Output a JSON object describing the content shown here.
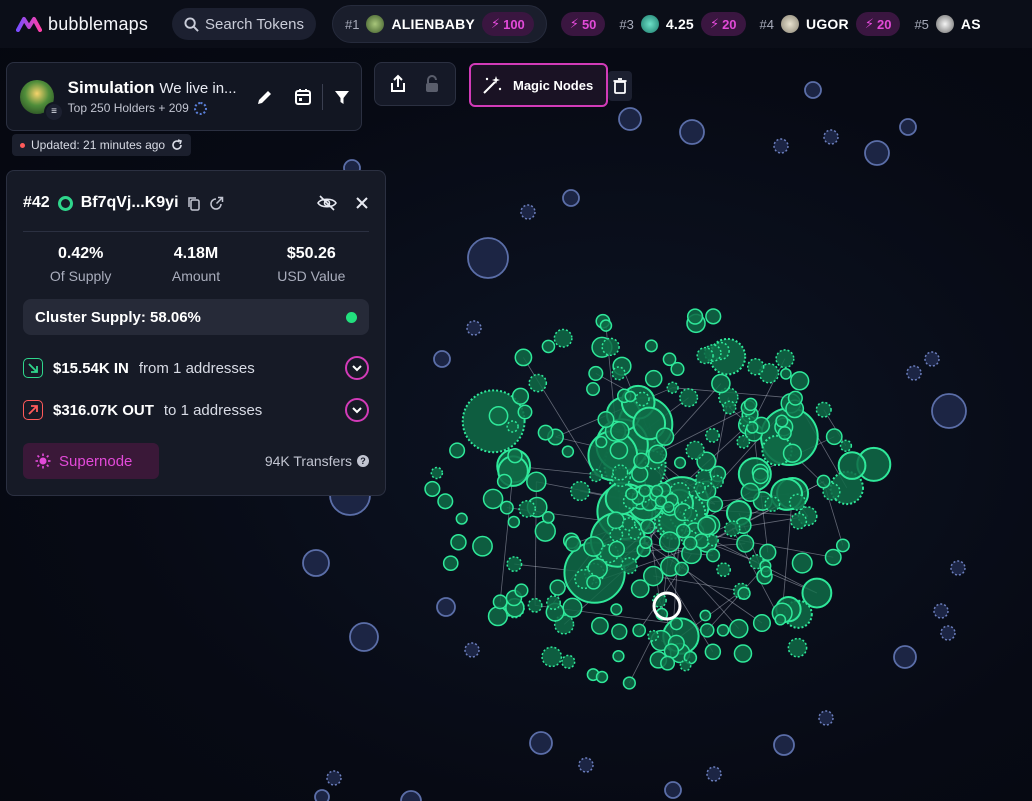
{
  "app": {
    "name": "bubblemaps"
  },
  "search": {
    "placeholder": "Search Tokens"
  },
  "tokens": [
    {
      "rank": "#1",
      "name": "ALIENBABY",
      "boost": "100"
    },
    {
      "rank": "",
      "name": "",
      "boost": "50"
    },
    {
      "rank": "#3",
      "name": "4.25",
      "boost": "20"
    },
    {
      "rank": "#4",
      "name": "UGOR",
      "boost": "20"
    },
    {
      "rank": "#5",
      "name": "AS",
      "boost": ""
    }
  ],
  "simulation": {
    "title": "Simulation",
    "subtitle": "We live in...",
    "holders": "Top 250 Holders + 209"
  },
  "updated": "Updated: 21 minutes ago",
  "magic_nodes": "Magic Nodes",
  "detail": {
    "rank": "#42",
    "address": "Bf7qVj...K9yi",
    "stats": [
      {
        "value": "0.42%",
        "label": "Of Supply"
      },
      {
        "value": "4.18M",
        "label": "Amount"
      },
      {
        "value": "$50.26",
        "label": "USD Value"
      }
    ],
    "cluster_supply": "Cluster Supply: 58.06%",
    "inflow": {
      "amount": "$15.54K IN",
      "text": "from 1 addresses"
    },
    "outflow": {
      "amount": "$316.07K OUT",
      "text": "to 1 addresses"
    },
    "supernode": "Supernode",
    "transfers": "94K Transfers"
  },
  "colors": {
    "accent": "#d23bb8",
    "green": "#2fd68c",
    "blue_node": "#3b4a78",
    "background": "#070a14"
  }
}
